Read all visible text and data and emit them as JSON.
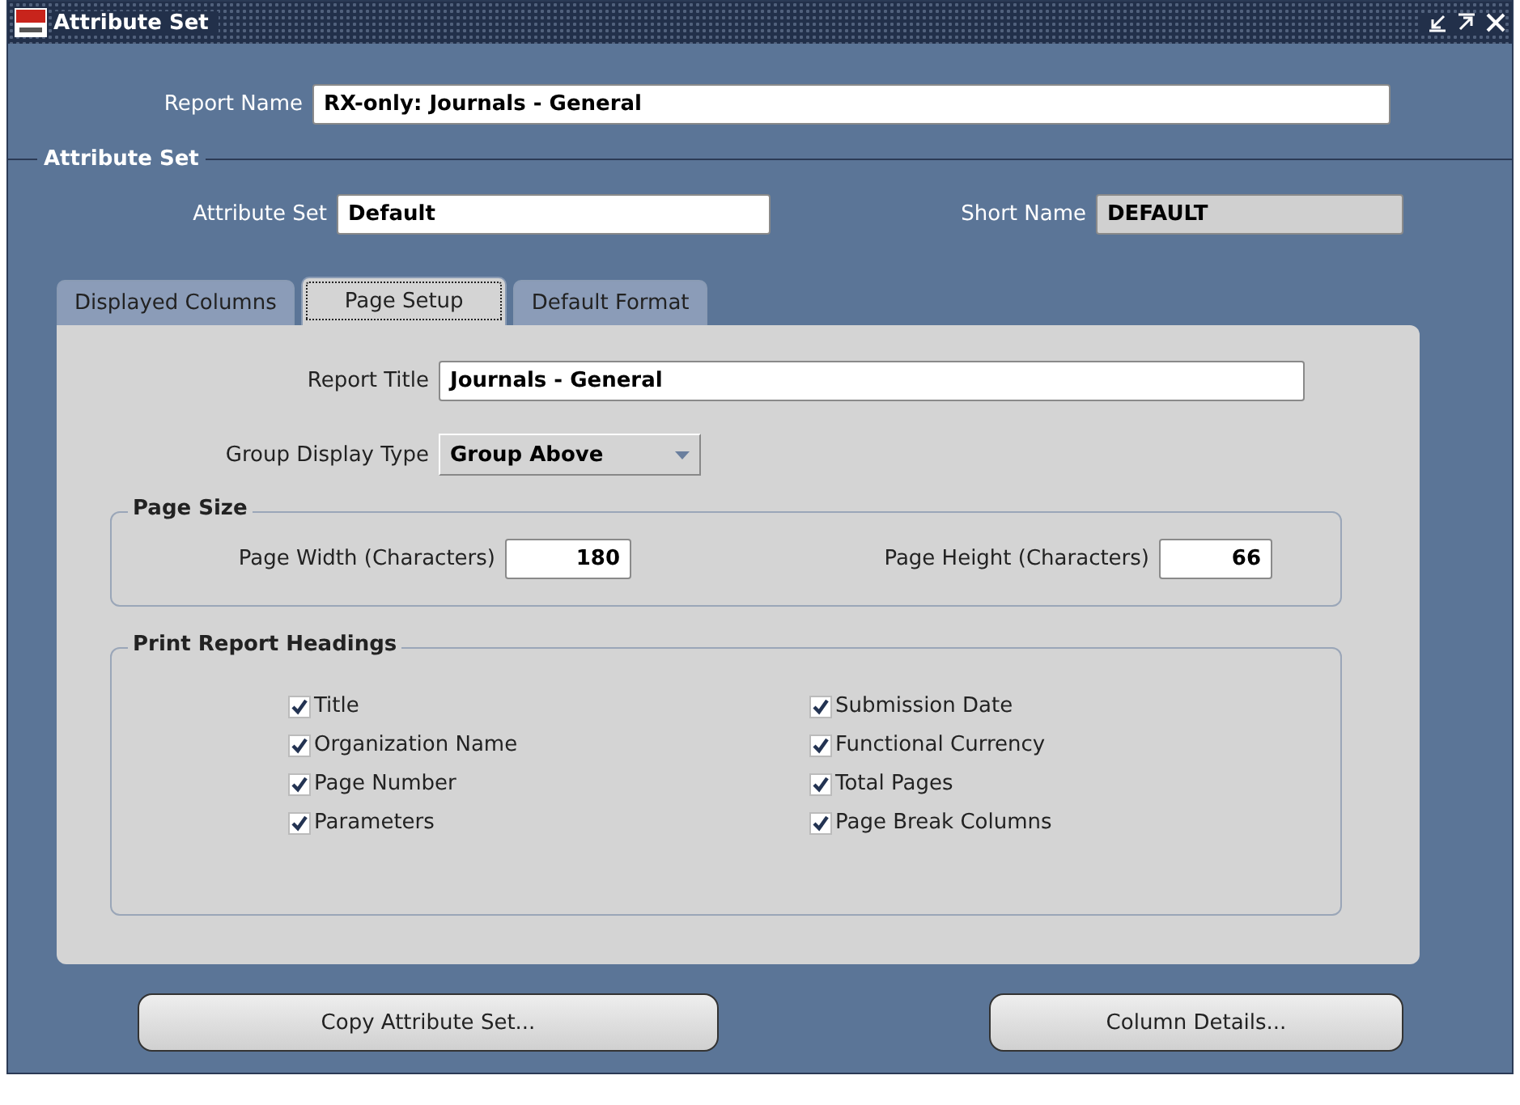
{
  "window": {
    "title": "Attribute Set"
  },
  "report_name": {
    "label": "Report Name",
    "value": "RX-only: Journals - General"
  },
  "attribute_set_section": {
    "title": "Attribute Set",
    "attribute_set": {
      "label": "Attribute Set",
      "value": "Default"
    },
    "short_name": {
      "label": "Short Name",
      "value": "DEFAULT",
      "disabled": true
    }
  },
  "tabs": [
    {
      "label": "Displayed Columns",
      "selected": false
    },
    {
      "label": "Page Setup",
      "selected": true
    },
    {
      "label": "Default Format",
      "selected": false
    }
  ],
  "report_title": {
    "label": "Report Title",
    "value": "Journals - General"
  },
  "group_display_type": {
    "label": "Group Display Type",
    "value": "Group Above"
  },
  "page_size": {
    "title": "Page Size",
    "fields": [
      {
        "label": "Page Width (Characters)",
        "value": "180"
      },
      {
        "label": "Page Height (Characters)",
        "value": "66"
      }
    ]
  },
  "print_report_headings": {
    "title": "Print Report Headings",
    "items": [
      {
        "label": "Title",
        "checked": true
      },
      {
        "label": "Submission Date",
        "checked": true
      },
      {
        "label": "Organization Name",
        "checked": true
      },
      {
        "label": "Functional Currency",
        "checked": true
      },
      {
        "label": "Page Number",
        "checked": true
      },
      {
        "label": "Total Pages",
        "checked": true
      },
      {
        "label": "Parameters",
        "checked": true
      },
      {
        "label": "Page Break Columns",
        "checked": true
      }
    ]
  },
  "buttons": [
    {
      "label": "Copy Attribute Set..."
    },
    {
      "label": "Column Details..."
    }
  ]
}
